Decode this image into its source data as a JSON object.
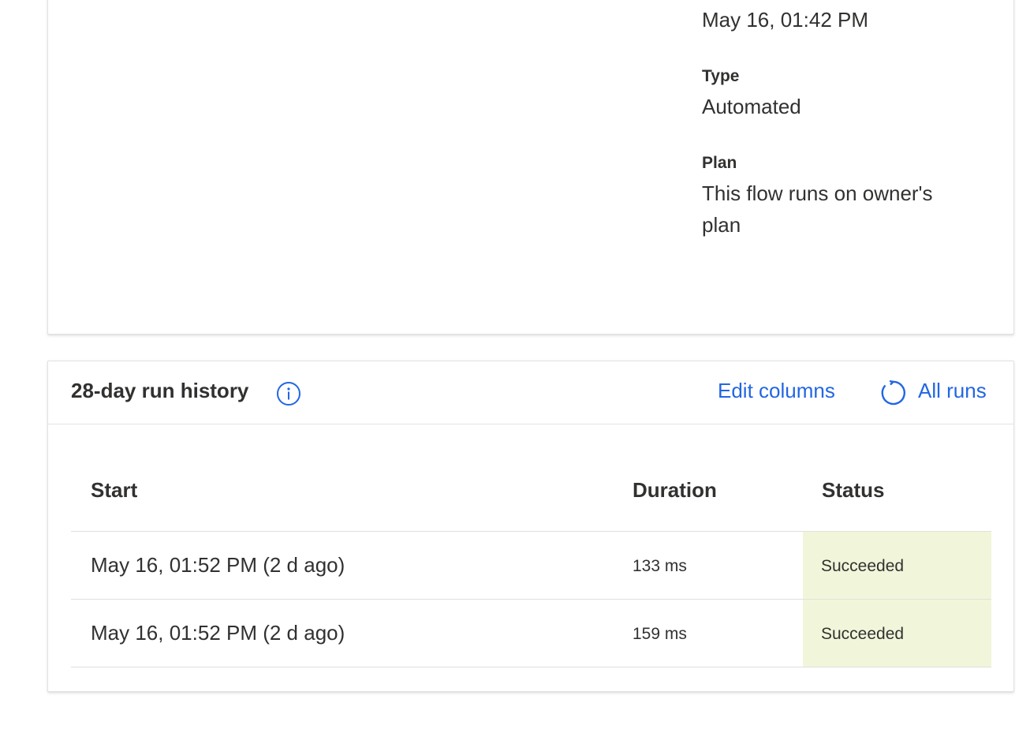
{
  "details": {
    "modified_value": "May 16, 01:42 PM",
    "type_label": "Type",
    "type_value": "Automated",
    "plan_label": "Plan",
    "plan_value_line1": "This flow runs on owner's",
    "plan_value_line2": "plan"
  },
  "run_history": {
    "title": "28-day run history",
    "edit_columns_label": "Edit columns",
    "all_runs_label": "All runs",
    "icons": {
      "info": "info-icon",
      "refresh": "refresh-icon"
    },
    "accent_color": "#2266e3",
    "columns": {
      "start": "Start",
      "duration": "Duration",
      "status": "Status"
    },
    "rows": [
      {
        "start": "May 16, 01:52 PM (2 d ago)",
        "duration": "133 ms",
        "status": "Succeeded"
      },
      {
        "start": "May 16, 01:52 PM (2 d ago)",
        "duration": "159 ms",
        "status": "Succeeded"
      }
    ],
    "status_color": "#f1f6da"
  }
}
